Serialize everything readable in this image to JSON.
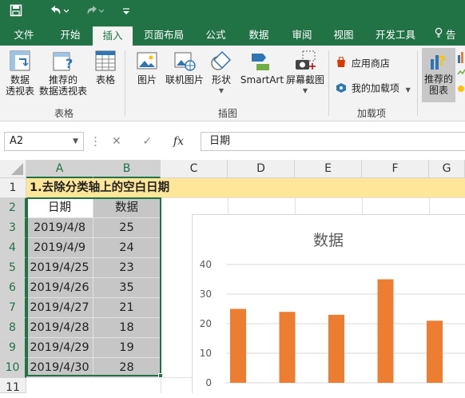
{
  "title_bar": {
    "save_icon": "save-icon",
    "undo_icon": "undo-icon",
    "redo_icon": "redo-icon",
    "customize_icon": "customize-qat-icon"
  },
  "tabs": [
    {
      "label": "文件"
    },
    {
      "label": "开始"
    },
    {
      "label": "插入",
      "active": true
    },
    {
      "label": "页面布局"
    },
    {
      "label": "公式"
    },
    {
      "label": "数据"
    },
    {
      "label": "审阅"
    },
    {
      "label": "视图"
    },
    {
      "label": "开发工具"
    },
    {
      "label": "告"
    }
  ],
  "ribbon": {
    "groups": [
      {
        "label": "表格",
        "buttons": [
          "数据\n透视表",
          "推荐的\n数据透视表",
          "表格"
        ]
      },
      {
        "label": "插图",
        "buttons": [
          "图片",
          "联机图片",
          "形状",
          "SmartArt",
          "屏幕截图"
        ]
      },
      {
        "label": "加载项",
        "buttons": [
          "应用商店",
          "我的加载项"
        ]
      }
    ],
    "recommended_charts": "推荐的\n图表"
  },
  "formula_bar": {
    "name_box": "A2",
    "cancel_icon": "✕",
    "enter_icon": "✓",
    "fx_label": "fx",
    "content": "日期"
  },
  "sheet": {
    "columns": [
      "A",
      "B",
      "C",
      "D",
      "E",
      "F",
      "G"
    ],
    "rows": [
      "1",
      "2",
      "3",
      "4",
      "5",
      "6",
      "7",
      "8",
      "9",
      "10",
      "11"
    ],
    "title": "1.去除分类轴上的空白日期",
    "header": [
      "日期",
      "数据"
    ],
    "data": [
      [
        "2019/4/8",
        "25"
      ],
      [
        "2019/4/9",
        "24"
      ],
      [
        "2019/4/25",
        "23"
      ],
      [
        "2019/4/26",
        "35"
      ],
      [
        "2019/4/27",
        "21"
      ],
      [
        "2019/4/28",
        "18"
      ],
      [
        "2019/4/29",
        "19"
      ],
      [
        "2019/4/30",
        "28"
      ]
    ]
  },
  "chart_data": {
    "type": "bar",
    "title": "数据",
    "ylim": [
      0,
      40
    ],
    "yticks": [
      "40",
      "30",
      "20",
      "10",
      "0"
    ],
    "values": [
      25,
      24,
      23,
      35,
      21
    ],
    "bar_color": "#ed7d31"
  },
  "colors": {
    "accent": "#217346",
    "title_fill": "#ffe699",
    "selection": "#c6c6c6",
    "arrow": "#e02020"
  }
}
